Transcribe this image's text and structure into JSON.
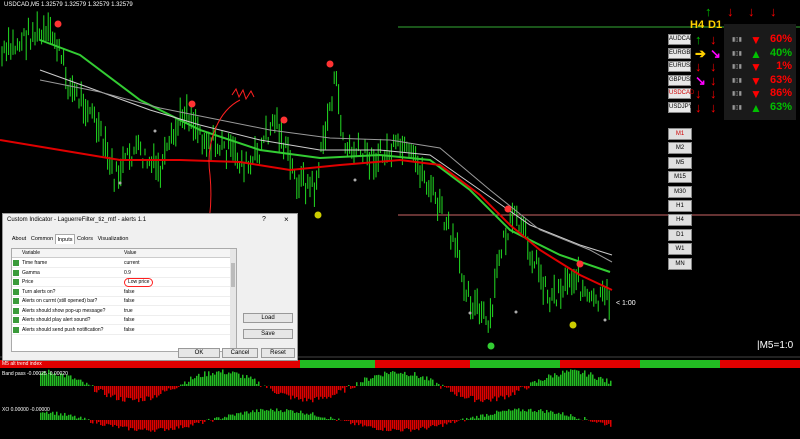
{
  "window": {
    "title": "USDCAD,M5  1.32579 1.32579 1.32579 1.32579"
  },
  "symbols": [
    {
      "label": "AUDCAD",
      "active": false,
      "h4": "up",
      "d1": "down",
      "arrow_color": "#00c000",
      "pct": "60%",
      "pct_dir": "down"
    },
    {
      "label": "EURGBP",
      "active": false,
      "h4": "right",
      "d1": "diag-down",
      "arrow_color": "#ffd000",
      "pct": "40%",
      "pct_dir": "up"
    },
    {
      "label": "EURUSD",
      "active": false,
      "h4": "down",
      "d1": "down",
      "arrow_color": "#ff0000",
      "pct": "1%",
      "pct_dir": "down"
    },
    {
      "label": "GBPUSD",
      "active": false,
      "h4": "diag-down",
      "d1": "down",
      "arrow_color": "#ff00ff",
      "pct": "63%",
      "pct_dir": "down"
    },
    {
      "label": "USDCAD",
      "active": true,
      "h4": "down",
      "d1": "down",
      "arrow_color": "#ff0000",
      "pct": "86%",
      "pct_dir": "down"
    },
    {
      "label": "USDJPY",
      "active": false,
      "h4": "down",
      "d1": "down",
      "arrow_color": "#ff0000",
      "pct": "63%",
      "pct_dir": "up"
    }
  ],
  "headers": {
    "h4": "H4",
    "d1": "D1"
  },
  "timeframes": [
    "M1",
    "M2",
    "M5",
    "M15",
    "M30",
    "H1",
    "H4",
    "D1",
    "W1",
    "MN"
  ],
  "active_timeframe": "M1",
  "indicator_labels": {
    "m5": "M5 alt trend index",
    "band": "Band pass  -0.00025  -0.00020",
    "xo": "XO  0.00000  -0.00000"
  },
  "m5_value": "|M5=1:0",
  "price_tag": "< 1:00",
  "dialog": {
    "title": "Custom Indicator - LaguerreFilter_tiz_mtf - alerts 1.1",
    "help": "?",
    "close": "×",
    "tabs": [
      "About",
      "Common",
      "Inputs",
      "Colors",
      "Visualization"
    ],
    "active_tab": "Inputs",
    "col_variable": "Variable",
    "col_value": "Value",
    "params": [
      {
        "name": "Time frame",
        "value": "current"
      },
      {
        "name": "Gamma",
        "value": "0.9"
      },
      {
        "name": "Price",
        "value": "Low price"
      },
      {
        "name": "Turn alerts on?",
        "value": "false"
      },
      {
        "name": "Alerts on currnt (still opened) bar?",
        "value": "false"
      },
      {
        "name": "Alerts should show pop-up message?",
        "value": "true"
      },
      {
        "name": "Alerts should play alert sound?",
        "value": "false"
      },
      {
        "name": "Alerts should send push notification?",
        "value": "false"
      }
    ],
    "load": "Load",
    "save": "Save",
    "ok": "OK",
    "cancel": "Cancel",
    "reset": "Reset"
  },
  "colors": {
    "up": "#00c000",
    "down": "#ff0000",
    "candles": "#22dd22",
    "laguerre": "#e00000",
    "fast_ma": "#33cc33"
  }
}
